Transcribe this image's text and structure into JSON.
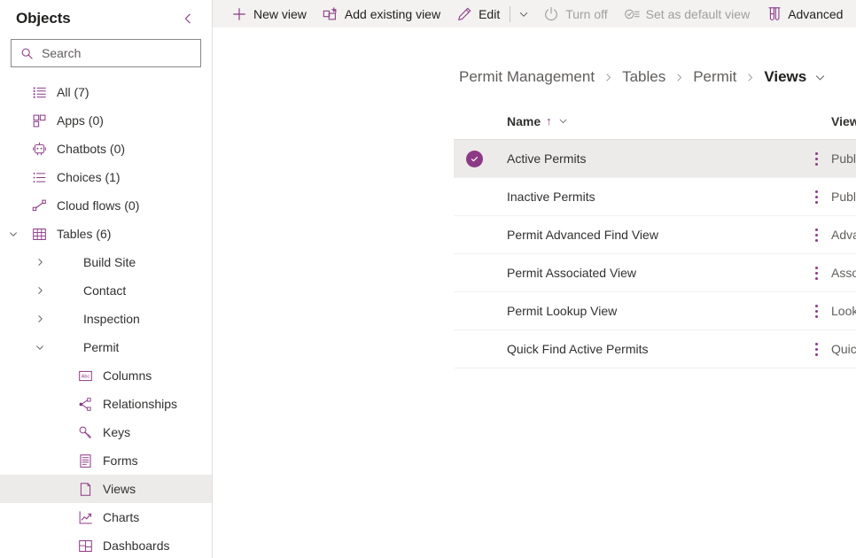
{
  "sidebar": {
    "title": "Objects",
    "collapse_icon": "chevron-left-icon",
    "search": {
      "placeholder": "Search",
      "value": "",
      "icon": "search-icon"
    },
    "items": [
      {
        "label": "All (7)",
        "icon": "list-all-icon",
        "level": 1,
        "chevron": "",
        "selected": false
      },
      {
        "label": "Apps (0)",
        "icon": "apps-grid-icon",
        "level": 1,
        "chevron": "",
        "selected": false
      },
      {
        "label": "Chatbots (0)",
        "icon": "chatbot-icon",
        "level": 1,
        "chevron": "",
        "selected": false
      },
      {
        "label": "Choices (1)",
        "icon": "bulleted-list-icon",
        "level": 1,
        "chevron": "",
        "selected": false
      },
      {
        "label": "Cloud flows (0)",
        "icon": "cloud-flow-icon",
        "level": 1,
        "chevron": "",
        "selected": false
      },
      {
        "label": "Tables (6)",
        "icon": "table-icon",
        "level": 1,
        "chevron": "down",
        "selected": false
      },
      {
        "label": "Build Site",
        "icon": "",
        "level": 2,
        "chevron": "right",
        "selected": false
      },
      {
        "label": "Contact",
        "icon": "",
        "level": 2,
        "chevron": "right",
        "selected": false
      },
      {
        "label": "Inspection",
        "icon": "",
        "level": 2,
        "chevron": "right",
        "selected": false
      },
      {
        "label": "Permit",
        "icon": "",
        "level": 2,
        "chevron": "down",
        "selected": false
      },
      {
        "label": "Columns",
        "icon": "columns-abc-icon",
        "level": 3,
        "chevron": "",
        "selected": false
      },
      {
        "label": "Relationships",
        "icon": "relationships-icon",
        "level": 3,
        "chevron": "",
        "selected": false
      },
      {
        "label": "Keys",
        "icon": "key-icon",
        "level": 3,
        "chevron": "",
        "selected": false
      },
      {
        "label": "Forms",
        "icon": "form-icon",
        "level": 3,
        "chevron": "",
        "selected": false
      },
      {
        "label": "Views",
        "icon": "view-page-icon",
        "level": 3,
        "chevron": "",
        "selected": true
      },
      {
        "label": "Charts",
        "icon": "chart-line-icon",
        "level": 3,
        "chevron": "",
        "selected": false
      },
      {
        "label": "Dashboards",
        "icon": "dashboard-icon",
        "level": 3,
        "chevron": "",
        "selected": false
      }
    ]
  },
  "command_bar": {
    "items": [
      {
        "label": "New view",
        "icon": "plus-icon",
        "disabled": false,
        "caret": false
      },
      {
        "label": "Add existing view",
        "icon": "add-existing-icon",
        "disabled": false,
        "caret": false
      },
      {
        "label": "Edit",
        "icon": "pencil-icon",
        "disabled": false,
        "caret": true
      },
      {
        "label": "Turn off",
        "icon": "power-icon",
        "disabled": true,
        "caret": false
      },
      {
        "label": "Set as default view",
        "icon": "set-default-icon",
        "disabled": true,
        "caret": false
      },
      {
        "label": "Advanced",
        "icon": "test-tubes-icon",
        "disabled": false,
        "caret": true
      }
    ]
  },
  "breadcrumb": {
    "items": [
      "Permit Management",
      "Tables",
      "Permit",
      "Views"
    ],
    "separator": "chevron-right-icon",
    "caret_icon": "chevron-down-icon"
  },
  "grid": {
    "columns": [
      {
        "key": "name",
        "label": "Name",
        "sort": "↑",
        "caret": "chevron-down-icon"
      },
      {
        "key": "type",
        "label": "View type",
        "sort": "",
        "caret": "chevron-down-icon"
      }
    ],
    "kebab_icon": "more-vertical-icon",
    "selected_icon": "check-circle-icon",
    "rows": [
      {
        "name": "Active Permits",
        "type": "Public View",
        "badge": "default",
        "selected": true
      },
      {
        "name": "Inactive Permits",
        "type": "Public View",
        "badge": "",
        "selected": false
      },
      {
        "name": "Permit Advanced Find View",
        "type": "Advanced Find View",
        "badge": "default",
        "selected": false
      },
      {
        "name": "Permit Associated View",
        "type": "Associated View",
        "badge": "default",
        "selected": false
      },
      {
        "name": "Permit Lookup View",
        "type": "Lookup View",
        "badge": "default",
        "selected": false
      },
      {
        "name": "Quick Find Active Permits",
        "type": "Quick Find View",
        "badge": "default",
        "selected": false
      }
    ]
  },
  "colors": {
    "accent": "#8c3a86",
    "command_bar_bg": "#f3f2f1",
    "selected_row_bg": "#edebe9",
    "text_primary": "#323130",
    "text_secondary": "#605e5c",
    "disabled_text": "#a19f9d"
  }
}
